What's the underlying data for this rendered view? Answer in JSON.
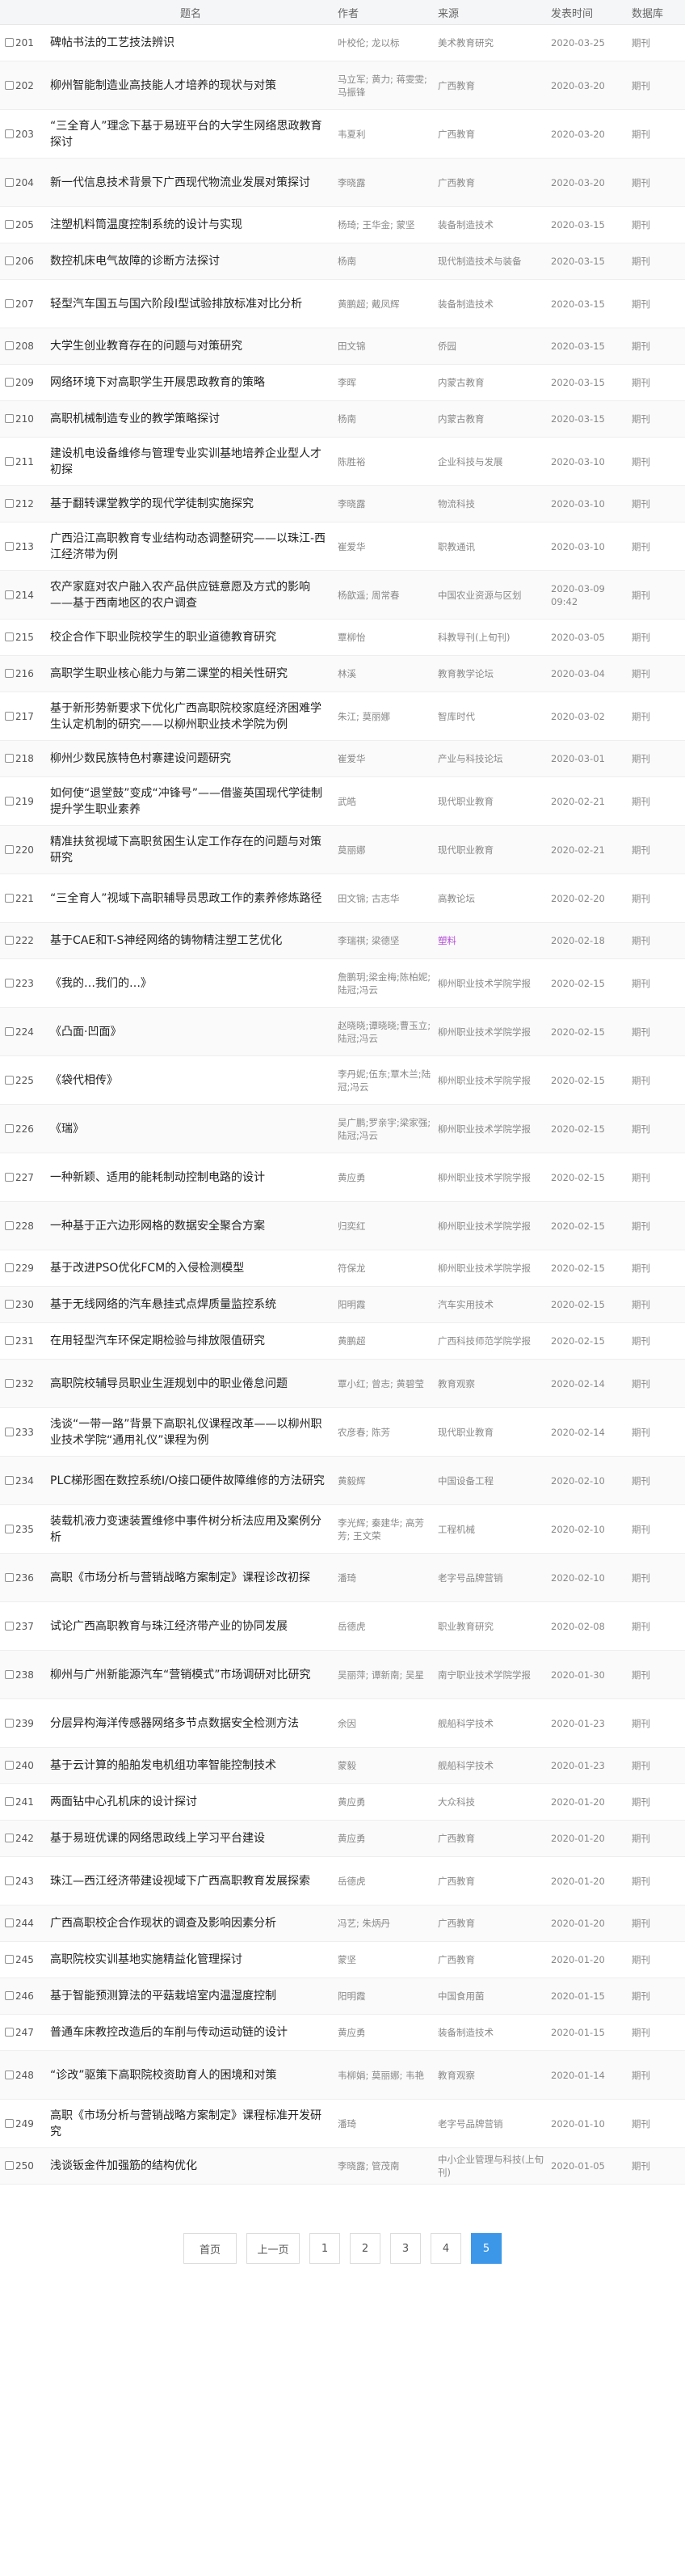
{
  "table": {
    "headers": {
      "title": "题名",
      "author": "作者",
      "source": "来源",
      "date": "发表时间",
      "db": "数据库"
    },
    "rows": [
      {
        "num": "201",
        "title": "碑帖书法的工艺技法辨识",
        "author": "叶校伦; 龙以标",
        "source": "美术教育研究",
        "date": "2020-03-25",
        "db": "期刊"
      },
      {
        "num": "202",
        "title": "柳州智能制造业高技能人才培养的现状与对策",
        "author": "马立军; 黄力; 蒋雯雯; 马振锋",
        "source": "广西教育",
        "date": "2020-03-20",
        "db": "期刊"
      },
      {
        "num": "203",
        "title": "“三全育人”理念下基于易班平台的大学生网络思政教育探讨",
        "author": "韦夏利",
        "source": "广西教育",
        "date": "2020-03-20",
        "db": "期刊"
      },
      {
        "num": "204",
        "title": "新一代信息技术背景下广西现代物流业发展对策探讨",
        "author": "李晓露",
        "source": "广西教育",
        "date": "2020-03-20",
        "db": "期刊"
      },
      {
        "num": "205",
        "title": "注塑机料筒温度控制系统的设计与实现",
        "author": "杨琦; 王华金; 蒙坚",
        "source": "装备制造技术",
        "date": "2020-03-15",
        "db": "期刊"
      },
      {
        "num": "206",
        "title": "数控机床电气故障的诊断方法探讨",
        "author": "杨南",
        "source": "现代制造技术与装备",
        "date": "2020-03-15",
        "db": "期刊"
      },
      {
        "num": "207",
        "title": "轻型汽车国五与国六阶段Ⅰ型试验排放标准对比分析",
        "author": "黄鹏超; 戴凤辉",
        "source": "装备制造技术",
        "date": "2020-03-15",
        "db": "期刊"
      },
      {
        "num": "208",
        "title": "大学生创业教育存在的问题与对策研究",
        "author": "田文锦",
        "source": "侨园",
        "date": "2020-03-15",
        "db": "期刊"
      },
      {
        "num": "209",
        "title": "网络环境下对高职学生开展思政教育的策略",
        "author": "李晖",
        "source": "内蒙古教育",
        "date": "2020-03-15",
        "db": "期刊"
      },
      {
        "num": "210",
        "title": "高职机械制造专业的教学策略探讨",
        "author": "杨南",
        "source": "内蒙古教育",
        "date": "2020-03-15",
        "db": "期刊"
      },
      {
        "num": "211",
        "title": "建设机电设备维修与管理专业实训基地培养企业型人才初探",
        "author": "陈胜裕",
        "source": "企业科技与发展",
        "date": "2020-03-10",
        "db": "期刊"
      },
      {
        "num": "212",
        "title": "基于翻转课堂教学的现代学徒制实施探究",
        "author": "李晓露",
        "source": "物流科技",
        "date": "2020-03-10",
        "db": "期刊"
      },
      {
        "num": "213",
        "title": "广西沿江高职教育专业结构动态调整研究——以珠江-西江经济带为例",
        "author": "崔爱华",
        "source": "职教通讯",
        "date": "2020-03-10",
        "db": "期刊"
      },
      {
        "num": "214",
        "title": "农产家庭对农户融入农产品供应链意愿及方式的影响——基于西南地区的农户调查",
        "author": "杨歆遥; 周常春",
        "source": "中国农业资源与区划",
        "date": "2020-03-09 09:42",
        "db": "期刊"
      },
      {
        "num": "215",
        "title": "校企合作下职业院校学生的职业道德教育研究",
        "author": "覃柳怡",
        "source": "科教导刊(上旬刊)",
        "date": "2020-03-05",
        "db": "期刊"
      },
      {
        "num": "216",
        "title": "高职学生职业核心能力与第二课堂的相关性研究",
        "author": "林溪",
        "source": "教育教学论坛",
        "date": "2020-03-04",
        "db": "期刊"
      },
      {
        "num": "217",
        "title": "基于新形势新要求下优化广西高职院校家庭经济困难学生认定机制的研究——以柳州职业技术学院为例",
        "author": "朱江; 莫丽娜",
        "source": "智库时代",
        "date": "2020-03-02",
        "db": "期刊"
      },
      {
        "num": "218",
        "title": "柳州少数民族特色村寨建设问题研究",
        "author": "崔爱华",
        "source": "产业与科技论坛",
        "date": "2020-03-01",
        "db": "期刊"
      },
      {
        "num": "219",
        "title": "如何使“退堂鼓”变成“冲锋号”——借鉴英国现代学徒制提升学生职业素养",
        "author": "武皓",
        "source": "现代职业教育",
        "date": "2020-02-21",
        "db": "期刊"
      },
      {
        "num": "220",
        "title": "精准扶贫视域下高职贫困生认定工作存在的问题与对策研究",
        "author": "莫丽娜",
        "source": "现代职业教育",
        "date": "2020-02-21",
        "db": "期刊"
      },
      {
        "num": "221",
        "title": "“三全育人”视域下高职辅导员思政工作的素养修炼路径",
        "author": "田文锦; 古志华",
        "source": "高教论坛",
        "date": "2020-02-20",
        "db": "期刊"
      },
      {
        "num": "222",
        "title": "基于CAE和T-S神经网络的铸物精注塑工艺优化",
        "author": "李瑞祺; 梁德坚",
        "source": "塑料",
        "source_accent": true,
        "date": "2020-02-18",
        "db": "期刊"
      },
      {
        "num": "223",
        "title": "《我的…我们的…》",
        "author": "詹鹏玥;梁金梅;陈柏妮;陆冠;冯云",
        "source": "柳州职业技术学院学报",
        "date": "2020-02-15",
        "db": "期刊"
      },
      {
        "num": "224",
        "title": "《凸面·凹面》",
        "author": "赵晓晓;谭晓晓;曹玉立;陆冠;冯云",
        "source": "柳州职业技术学院学报",
        "date": "2020-02-15",
        "db": "期刊"
      },
      {
        "num": "225",
        "title": "《袋代相传》",
        "author": "李丹妮;伍东;覃木兰;陆冠;冯云",
        "source": "柳州职业技术学院学报",
        "date": "2020-02-15",
        "db": "期刊"
      },
      {
        "num": "226",
        "title": "《瑞》",
        "author": "吴广鹏;罗亲宇;梁家强;陆冠;冯云",
        "source": "柳州职业技术学院学报",
        "date": "2020-02-15",
        "db": "期刊"
      },
      {
        "num": "227",
        "title": "一种新颖、适用的能耗制动控制电路的设计",
        "author": "黄应勇",
        "source": "柳州职业技术学院学报",
        "date": "2020-02-15",
        "db": "期刊"
      },
      {
        "num": "228",
        "title": "一种基于正六边形网格的数据安全聚合方案",
        "author": "归奕红",
        "source": "柳州职业技术学院学报",
        "date": "2020-02-15",
        "db": "期刊"
      },
      {
        "num": "229",
        "title": "基于改进PSO优化FCM的入侵检测模型",
        "author": "符保龙",
        "source": "柳州职业技术学院学报",
        "date": "2020-02-15",
        "db": "期刊"
      },
      {
        "num": "230",
        "title": "基于无线网络的汽车悬挂式点焊质量监控系统",
        "author": "阳明霞",
        "source": "汽车实用技术",
        "date": "2020-02-15",
        "db": "期刊"
      },
      {
        "num": "231",
        "title": "在用轻型汽车环保定期检验与排放限值研究",
        "author": "黄鹏超",
        "source": "广西科技师范学院学报",
        "date": "2020-02-15",
        "db": "期刊"
      },
      {
        "num": "232",
        "title": "高职院校辅导员职业生涯规划中的职业倦怠问题",
        "author": "覃小红; 曾志; 黄碧莹",
        "source": "教育观察",
        "date": "2020-02-14",
        "db": "期刊"
      },
      {
        "num": "233",
        "title": "浅谈“一带一路”背景下高职礼仪课程改革——以柳州职业技术学院“通用礼仪”课程为例",
        "author": "农彦春; 陈芳",
        "source": "现代职业教育",
        "date": "2020-02-14",
        "db": "期刊"
      },
      {
        "num": "234",
        "title": "PLC梯形图在数控系统I/O接口硬件故障维修的方法研究",
        "author": "黄毅辉",
        "source": "中国设备工程",
        "date": "2020-02-10",
        "db": "期刊"
      },
      {
        "num": "235",
        "title": "装载机液力变速装置维修中事件树分析法应用及案例分析",
        "author": "李光辉; 秦建华; 高芳芳; 王文荣",
        "source": "工程机械",
        "date": "2020-02-10",
        "db": "期刊"
      },
      {
        "num": "236",
        "title": "高职《市场分析与营销战略方案制定》课程诊改初探",
        "author": "潘琦",
        "source": "老字号品牌营销",
        "date": "2020-02-10",
        "db": "期刊"
      },
      {
        "num": "237",
        "title": "试论广西高职教育与珠江经济带产业的协同发展",
        "author": "岳德虎",
        "source": "职业教育研究",
        "date": "2020-02-08",
        "db": "期刊"
      },
      {
        "num": "238",
        "title": "柳州与广州新能源汽车“营销模式”市场调研对比研究",
        "author": "吴丽萍; 谭新南; 吴星",
        "source": "南宁职业技术学院学报",
        "date": "2020-01-30",
        "db": "期刊"
      },
      {
        "num": "239",
        "title": "分层异构海洋传感器网络多节点数据安全检测方法",
        "author": "余因",
        "source": "舰船科学技术",
        "date": "2020-01-23",
        "db": "期刊"
      },
      {
        "num": "240",
        "title": "基于云计算的船舶发电机组功率智能控制技术",
        "author": "蒙毅",
        "source": "舰船科学技术",
        "date": "2020-01-23",
        "db": "期刊"
      },
      {
        "num": "241",
        "title": "两面钻中心孔机床的设计探讨",
        "author": "黄应勇",
        "source": "大众科技",
        "date": "2020-01-20",
        "db": "期刊"
      },
      {
        "num": "242",
        "title": "基于易班优课的网络思政线上学习平台建设",
        "author": "黄应勇",
        "source": "广西教育",
        "date": "2020-01-20",
        "db": "期刊"
      },
      {
        "num": "243",
        "title": "珠江—西江经济带建设视域下广西高职教育发展探索",
        "author": "岳德虎",
        "source": "广西教育",
        "date": "2020-01-20",
        "db": "期刊"
      },
      {
        "num": "244",
        "title": "广西高职校企合作现状的调查及影响因素分析",
        "author": "冯艺; 朱炳丹",
        "source": "广西教育",
        "date": "2020-01-20",
        "db": "期刊"
      },
      {
        "num": "245",
        "title": "高职院校实训基地实施精益化管理探讨",
        "author": "蒙坚",
        "source": "广西教育",
        "date": "2020-01-20",
        "db": "期刊"
      },
      {
        "num": "246",
        "title": "基于智能预测算法的平菇栽培室内温湿度控制",
        "author": "阳明霞",
        "source": "中国食用菌",
        "date": "2020-01-15",
        "db": "期刊"
      },
      {
        "num": "247",
        "title": "普通车床教控改造后的车削与传动运动链的设计",
        "author": "黄应勇",
        "source": "装备制造技术",
        "date": "2020-01-15",
        "db": "期刊"
      },
      {
        "num": "248",
        "title": "“诊改”驱策下高职院校资助育人的困境和对策",
        "author": "韦柳娟; 莫丽娜; 韦艳",
        "source": "教育观察",
        "date": "2020-01-14",
        "db": "期刊"
      },
      {
        "num": "249",
        "title": "高职《市场分析与营销战略方案制定》课程标准开发研究",
        "author": "潘琦",
        "source": "老字号品牌营销",
        "date": "2020-01-10",
        "db": "期刊"
      },
      {
        "num": "250",
        "title": "浅谈钣金件加强筋的结构优化",
        "author": "李晓露; 管茂南",
        "source": "中小企业管理与科技(上旬刊)",
        "date": "2020-01-05",
        "db": "期刊"
      }
    ]
  },
  "pagination": {
    "first": "首页",
    "prev": "上一页",
    "pages": [
      "1",
      "2",
      "3",
      "4",
      "5"
    ],
    "current": "5"
  },
  "colors": {
    "accent": "#3c97e8",
    "source_accent": "#b44bd8"
  }
}
